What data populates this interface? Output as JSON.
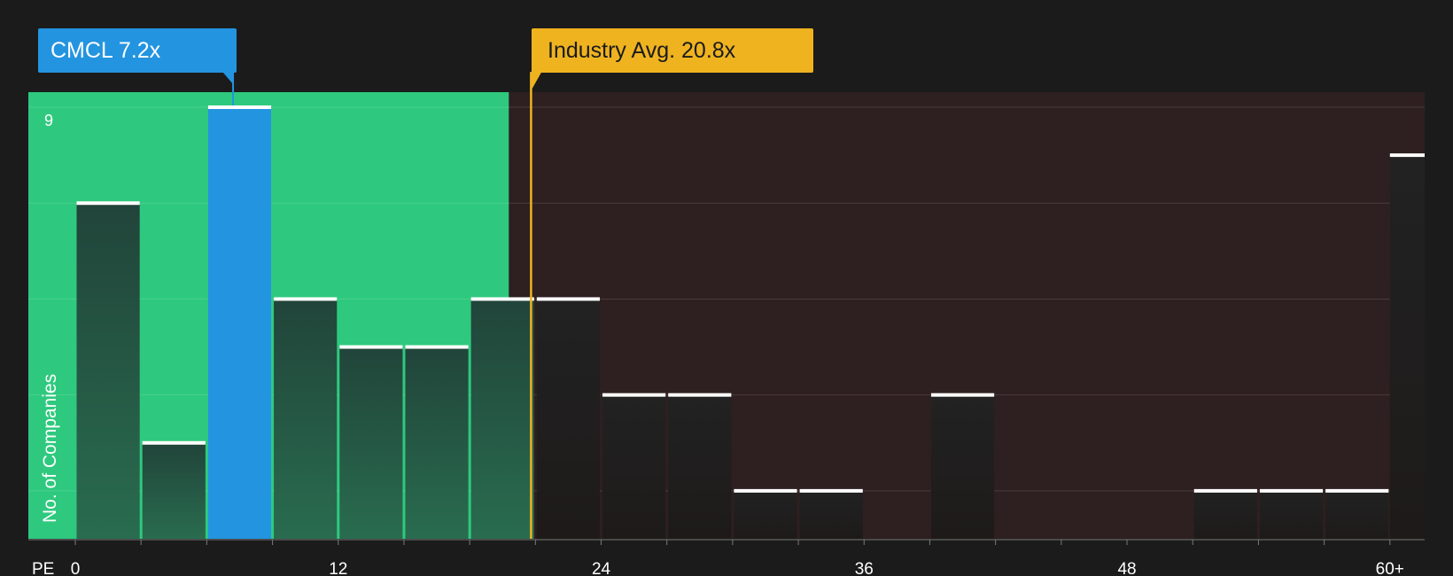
{
  "company_callout": {
    "label": "CMCL 7.2x",
    "value": 7.2
  },
  "industry_callout": {
    "label": "Industry Avg. 20.8x",
    "value": 20.8
  },
  "colors": {
    "background": "#1b1b1b",
    "undervalued_region": "#2ec97e",
    "overvalued_region": "#2e1f20",
    "company": "#2394e0",
    "industry": "#efb320",
    "bar_cap": "#ffffff"
  },
  "chart_data": {
    "type": "bar",
    "title": "",
    "xlabel": "PE",
    "ylabel": "No. of Companies",
    "x_ticks": [
      "0",
      "12",
      "24",
      "36",
      "48",
      "60+"
    ],
    "x_tick_values": [
      0,
      12,
      24,
      36,
      48,
      60
    ],
    "y_ticks": [
      "9"
    ],
    "y_tick_values": [
      9
    ],
    "xlim": [
      0,
      61.6
    ],
    "ylim": [
      0,
      9
    ],
    "bin_width": 3,
    "bins": [
      {
        "start": 0,
        "count": 7
      },
      {
        "start": 3,
        "count": 2
      },
      {
        "start": 6,
        "count": 9,
        "highlight": true
      },
      {
        "start": 9,
        "count": 5
      },
      {
        "start": 12,
        "count": 4
      },
      {
        "start": 15,
        "count": 4
      },
      {
        "start": 18,
        "count": 5
      },
      {
        "start": 21,
        "count": 5
      },
      {
        "start": 24,
        "count": 3
      },
      {
        "start": 27,
        "count": 3
      },
      {
        "start": 30,
        "count": 1
      },
      {
        "start": 33,
        "count": 1
      },
      {
        "start": 36,
        "count": 0
      },
      {
        "start": 39,
        "count": 3
      },
      {
        "start": 42,
        "count": 0
      },
      {
        "start": 45,
        "count": 0
      },
      {
        "start": 48,
        "count": 0
      },
      {
        "start": 51,
        "count": 1
      },
      {
        "start": 54,
        "count": 1
      },
      {
        "start": 57,
        "count": 1
      },
      {
        "start": 60,
        "count": 8,
        "overflow": true
      }
    ],
    "company_value": 7.2,
    "industry_avg": 20.8,
    "grid": true
  }
}
